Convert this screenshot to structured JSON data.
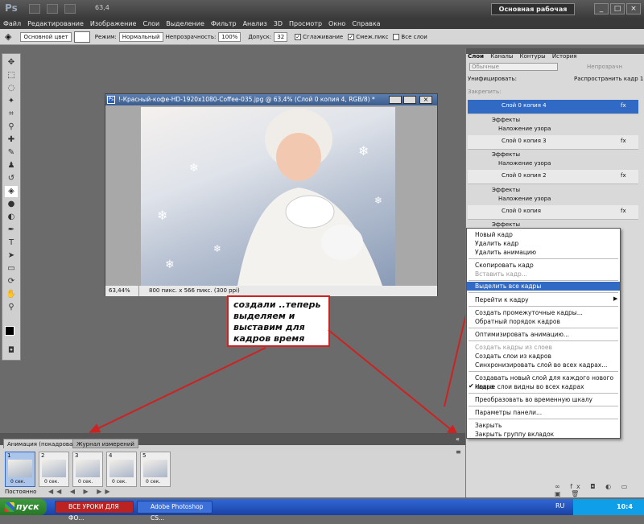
{
  "app": {
    "logo": "Ps",
    "zoom": "63,4",
    "workspace": "Основная рабочая среда"
  },
  "menu": [
    "Файл",
    "Редактирование",
    "Изображение",
    "Слои",
    "Выделение",
    "Фильтр",
    "Анализ",
    "3D",
    "Просмотр",
    "Окно",
    "Справка"
  ],
  "options": {
    "mode_preset": "Основной цвет",
    "mode_label": "Режим:",
    "mode_value": "Нормальный",
    "opacity_label": "Непрозрачность:",
    "opacity_value": "100%",
    "tolerance_label": "Допуск:",
    "tolerance_value": "32",
    "antialias": "Сглаживание",
    "contiguous": "Смеж.пикс",
    "all_layers": "Все слои"
  },
  "document": {
    "title": "!-Красный-кофе-HD-1920x1080-Coffee-035.jpg @ 63,4% (Слой 0 копия 4, RGB/8) *",
    "zoom": "63,44%",
    "info": "800 пикс. x 566 пикс. (300 ppi)"
  },
  "note": "создали ..теперь выделяем и выставим для кадров время",
  "layers_panel": {
    "tabs": [
      "Слои",
      "Каналы",
      "Контуры",
      "История"
    ],
    "blend": "Обычные",
    "opacity_label": "Непрозрачн",
    "unify_label": "Унифицировать:",
    "propagate": "Распространить кадр 1",
    "lock_label": "Закрепить:",
    "layers": [
      {
        "name": "Слой 0 копия 4",
        "effects": "Эффекты",
        "fx": "Наложение узора"
      },
      {
        "name": "Слой 0 копия 3",
        "effects": "Эффекты",
        "fx": "Наложение узора"
      },
      {
        "name": "Слой 0 копия 2",
        "effects": "Эффекты",
        "fx": "Наложение узора"
      },
      {
        "name": "Слой 0 копия",
        "effects": "Эффекты",
        "fx": ""
      }
    ]
  },
  "context_menu": [
    "Новый кадр",
    "Удалить кадр",
    "Удалить анимацию",
    "Скопировать кадр",
    "Вставить кадр...",
    "Выделить все кадры",
    "Перейти к кадру",
    "Создать промежуточные кадры...",
    "Обратный порядок кадров",
    "Оптимизировать анимацию...",
    "Создать кадры из слоев",
    "Создать слои из кадров",
    "Синхронизировать слой во всех кадрах...",
    "Создавать новый слой для каждого нового кадра",
    "Новые слои видны во всех кадрах",
    "Преобразовать во временную шкалу",
    "Параметры панели...",
    "Закрыть",
    "Закрыть группу вкладок"
  ],
  "animation": {
    "tabs": [
      "Анимация (покадровая)",
      "Журнал измерений"
    ],
    "frames": [
      "1",
      "2",
      "3",
      "4",
      "5"
    ],
    "delay": "0 сек.",
    "loop": "Постоянно"
  },
  "taskbar": {
    "start": "пуск",
    "tasks": [
      "ВСЕ УРОКИ ДЛЯ ФО...",
      "Adobe Photoshop CS..."
    ],
    "lang": "RU",
    "clock": "10:4"
  }
}
